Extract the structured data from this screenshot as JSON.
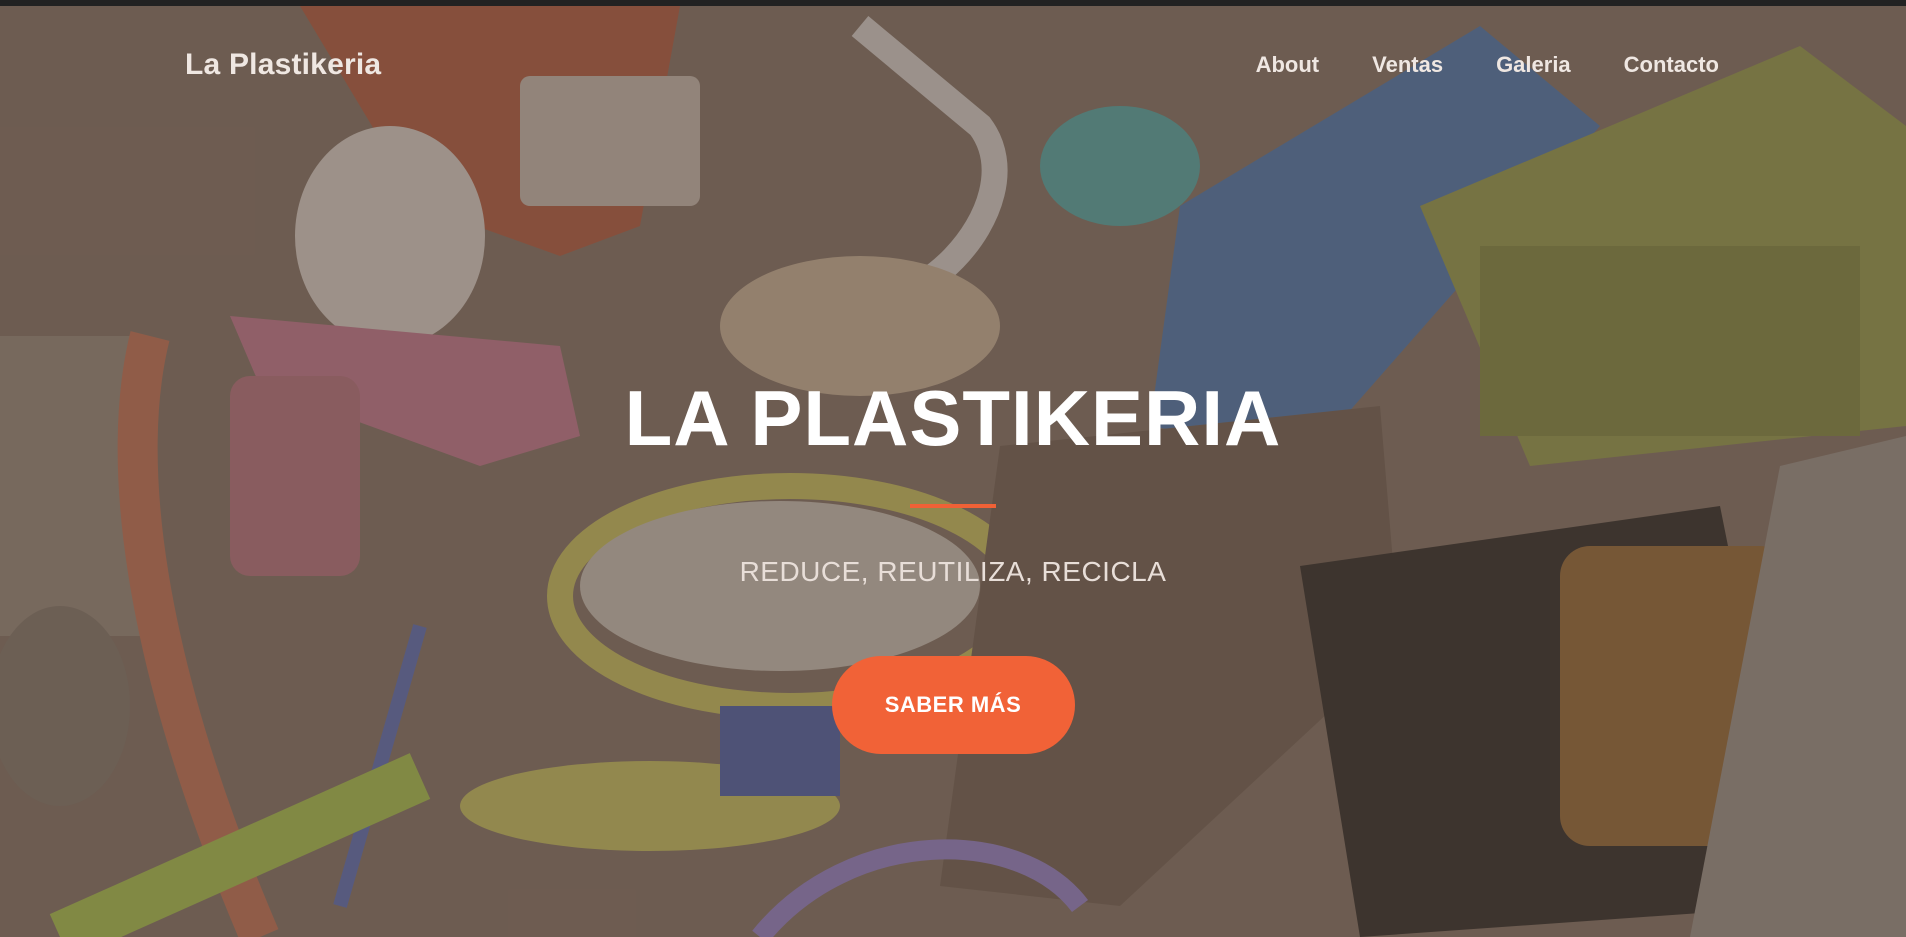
{
  "nav": {
    "brand": "La Plastikeria",
    "links": [
      "About",
      "Ventas",
      "Galeria",
      "Contacto"
    ]
  },
  "hero": {
    "title": "LA PLASTIKERIA",
    "subtitle": "REDUCE, REUTILIZA, RECICLA",
    "button_label": "SABER MÁS",
    "background_icon": "plastic-waste-photo"
  },
  "colors": {
    "accent": "#f16237",
    "title": "#ffffff",
    "nav_text": "#efe7e2",
    "overlay": "#58463c"
  }
}
